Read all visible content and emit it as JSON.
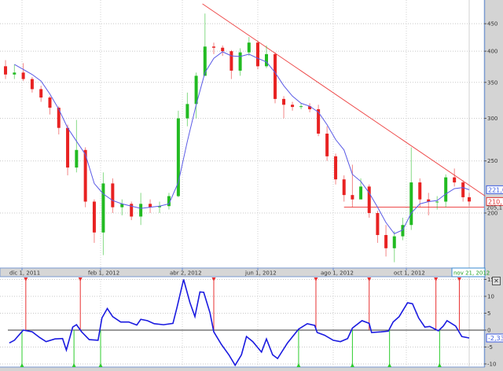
{
  "chart_data": [
    {
      "type": "candlestick",
      "panel": "price",
      "y_scale": "log",
      "ylim": [
        160,
        490
      ],
      "y_ticks": [
        "200",
        "250",
        "300",
        "350",
        "400",
        "450"
      ],
      "x_ticks": [
        "dic 1, 2011",
        "feb 1, 2012",
        "abr 2, 2012",
        "jun 1, 2012",
        "ago 1, 2012",
        "oct 1, 2012"
      ],
      "grid": true,
      "cursor_date_label": "nov 21, 2012",
      "colors": {
        "up": "#22bb22",
        "down": "#e82222",
        "ma": "#5a5ae6",
        "trendline": "#ee4a4a"
      },
      "ohlc": [
        {
          "date": "2011-11-18",
          "o": 375,
          "h": 385,
          "l": 355,
          "c": 362
        },
        {
          "date": "2011-11-25",
          "o": 362,
          "h": 378,
          "l": 355,
          "c": 365
        },
        {
          "date": "2011-12-02",
          "o": 365,
          "h": 380,
          "l": 352,
          "c": 355
        },
        {
          "date": "2011-12-09",
          "o": 355,
          "h": 358,
          "l": 335,
          "c": 340
        },
        {
          "date": "2011-12-16",
          "o": 340,
          "h": 345,
          "l": 322,
          "c": 328
        },
        {
          "date": "2011-12-23",
          "o": 328,
          "h": 330,
          "l": 305,
          "c": 314
        },
        {
          "date": "2011-12-30",
          "o": 314,
          "h": 316,
          "l": 280,
          "c": 288
        },
        {
          "date": "2012-01-06",
          "o": 288,
          "h": 292,
          "l": 235,
          "c": 243
        },
        {
          "date": "2012-01-13",
          "o": 243,
          "h": 298,
          "l": 238,
          "c": 262
        },
        {
          "date": "2012-01-20",
          "o": 262,
          "h": 265,
          "l": 205,
          "c": 210
        },
        {
          "date": "2012-01-27",
          "o": 210,
          "h": 212,
          "l": 176,
          "c": 184
        },
        {
          "date": "2012-02-03",
          "o": 184,
          "h": 238,
          "l": 167,
          "c": 227
        },
        {
          "date": "2012-02-10",
          "o": 227,
          "h": 232,
          "l": 200,
          "c": 205
        },
        {
          "date": "2012-02-17",
          "o": 205,
          "h": 212,
          "l": 198,
          "c": 208
        },
        {
          "date": "2012-02-24",
          "o": 208,
          "h": 210,
          "l": 194,
          "c": 197
        },
        {
          "date": "2012-03-02",
          "o": 197,
          "h": 218,
          "l": 190,
          "c": 208
        },
        {
          "date": "2012-03-09",
          "o": 208,
          "h": 212,
          "l": 200,
          "c": 205
        },
        {
          "date": "2012-03-16",
          "o": 205,
          "h": 210,
          "l": 200,
          "c": 206
        },
        {
          "date": "2012-03-23",
          "o": 206,
          "h": 218,
          "l": 203,
          "c": 215
        },
        {
          "date": "2012-03-30",
          "o": 215,
          "h": 310,
          "l": 214,
          "c": 300
        },
        {
          "date": "2012-04-06",
          "o": 300,
          "h": 335,
          "l": 290,
          "c": 319
        },
        {
          "date": "2012-04-13",
          "o": 319,
          "h": 365,
          "l": 300,
          "c": 360
        },
        {
          "date": "2012-04-20",
          "o": 360,
          "h": 470,
          "l": 360,
          "c": 408
        },
        {
          "date": "2012-04-27",
          "o": 408,
          "h": 415,
          "l": 395,
          "c": 406
        },
        {
          "date": "2012-05-04",
          "o": 406,
          "h": 410,
          "l": 392,
          "c": 400
        },
        {
          "date": "2012-05-11",
          "o": 400,
          "h": 402,
          "l": 355,
          "c": 368
        },
        {
          "date": "2012-05-18",
          "o": 368,
          "h": 405,
          "l": 360,
          "c": 398
        },
        {
          "date": "2012-05-25",
          "o": 398,
          "h": 425,
          "l": 392,
          "c": 415
        },
        {
          "date": "2012-06-01",
          "o": 415,
          "h": 418,
          "l": 370,
          "c": 375
        },
        {
          "date": "2012-06-08",
          "o": 375,
          "h": 410,
          "l": 372,
          "c": 395
        },
        {
          "date": "2012-06-15",
          "o": 395,
          "h": 398,
          "l": 320,
          "c": 326
        },
        {
          "date": "2012-06-22",
          "o": 326,
          "h": 330,
          "l": 300,
          "c": 318
        },
        {
          "date": "2012-06-29",
          "o": 318,
          "h": 322,
          "l": 310,
          "c": 315
        },
        {
          "date": "2012-07-06",
          "o": 315,
          "h": 320,
          "l": 312,
          "c": 316
        },
        {
          "date": "2012-07-13",
          "o": 316,
          "h": 320,
          "l": 308,
          "c": 312
        },
        {
          "date": "2012-07-20",
          "o": 312,
          "h": 318,
          "l": 278,
          "c": 281
        },
        {
          "date": "2012-07-27",
          "o": 281,
          "h": 290,
          "l": 250,
          "c": 255
        },
        {
          "date": "2012-08-03",
          "o": 255,
          "h": 258,
          "l": 226,
          "c": 231
        },
        {
          "date": "2012-08-10",
          "o": 231,
          "h": 235,
          "l": 210,
          "c": 216
        },
        {
          "date": "2012-08-17",
          "o": 216,
          "h": 246,
          "l": 205,
          "c": 212
        },
        {
          "date": "2012-08-24",
          "o": 212,
          "h": 232,
          "l": 215,
          "c": 224
        },
        {
          "date": "2012-08-31",
          "o": 224,
          "h": 226,
          "l": 196,
          "c": 200
        },
        {
          "date": "2012-09-07",
          "o": 200,
          "h": 202,
          "l": 176,
          "c": 182
        },
        {
          "date": "2012-09-14",
          "o": 182,
          "h": 190,
          "l": 166,
          "c": 172
        },
        {
          "date": "2012-09-21",
          "o": 172,
          "h": 185,
          "l": 162,
          "c": 181
        },
        {
          "date": "2012-09-28",
          "o": 181,
          "h": 196,
          "l": 178,
          "c": 190
        },
        {
          "date": "2012-10-05",
          "o": 190,
          "h": 265,
          "l": 186,
          "c": 228
        },
        {
          "date": "2012-10-12",
          "o": 228,
          "h": 232,
          "l": 205,
          "c": 212
        },
        {
          "date": "2012-10-19",
          "o": 212,
          "h": 218,
          "l": 198,
          "c": 210
        },
        {
          "date": "2012-10-26",
          "o": 210,
          "h": 215,
          "l": 203,
          "c": 210
        },
        {
          "date": "2012-11-02",
          "o": 210,
          "h": 236,
          "l": 205,
          "c": 233
        },
        {
          "date": "2012-11-09",
          "o": 233,
          "h": 242,
          "l": 224,
          "c": 228
        },
        {
          "date": "2012-11-16",
          "o": 228,
          "h": 230,
          "l": 210,
          "c": 214
        },
        {
          "date": "2012-11-21",
          "o": 214,
          "h": 218,
          "l": 206,
          "c": 210.1
        }
      ],
      "moving_average": [
        {
          "date": "2011-11-25",
          "v": 378
        },
        {
          "date": "2011-12-02",
          "v": 370
        },
        {
          "date": "2011-12-09",
          "v": 362
        },
        {
          "date": "2011-12-16",
          "v": 352
        },
        {
          "date": "2011-12-23",
          "v": 333
        },
        {
          "date": "2011-12-30",
          "v": 312
        },
        {
          "date": "2012-01-06",
          "v": 288
        },
        {
          "date": "2012-01-13",
          "v": 272
        },
        {
          "date": "2012-01-20",
          "v": 257
        },
        {
          "date": "2012-01-27",
          "v": 227
        },
        {
          "date": "2012-02-03",
          "v": 217
        },
        {
          "date": "2012-02-10",
          "v": 211
        },
        {
          "date": "2012-02-17",
          "v": 208
        },
        {
          "date": "2012-02-24",
          "v": 206
        },
        {
          "date": "2012-03-02",
          "v": 204
        },
        {
          "date": "2012-03-09",
          "v": 205
        },
        {
          "date": "2012-03-16",
          "v": 206
        },
        {
          "date": "2012-03-23",
          "v": 208
        },
        {
          "date": "2012-03-30",
          "v": 228
        },
        {
          "date": "2012-04-06",
          "v": 272
        },
        {
          "date": "2012-04-13",
          "v": 318
        },
        {
          "date": "2012-04-20",
          "v": 365
        },
        {
          "date": "2012-04-27",
          "v": 388
        },
        {
          "date": "2012-05-04",
          "v": 399
        },
        {
          "date": "2012-05-11",
          "v": 392
        },
        {
          "date": "2012-05-18",
          "v": 391
        },
        {
          "date": "2012-05-25",
          "v": 395
        },
        {
          "date": "2012-06-01",
          "v": 388
        },
        {
          "date": "2012-06-08",
          "v": 382
        },
        {
          "date": "2012-06-15",
          "v": 365
        },
        {
          "date": "2012-06-22",
          "v": 345
        },
        {
          "date": "2012-06-29",
          "v": 330
        },
        {
          "date": "2012-07-06",
          "v": 320
        },
        {
          "date": "2012-07-13",
          "v": 316
        },
        {
          "date": "2012-07-20",
          "v": 308
        },
        {
          "date": "2012-07-27",
          "v": 292
        },
        {
          "date": "2012-08-03",
          "v": 274
        },
        {
          "date": "2012-08-10",
          "v": 262
        },
        {
          "date": "2012-08-17",
          "v": 236
        },
        {
          "date": "2012-08-24",
          "v": 229
        },
        {
          "date": "2012-08-31",
          "v": 218
        },
        {
          "date": "2012-09-07",
          "v": 205
        },
        {
          "date": "2012-09-14",
          "v": 192
        },
        {
          "date": "2012-09-21",
          "v": 183
        },
        {
          "date": "2012-09-28",
          "v": 186
        },
        {
          "date": "2012-10-05",
          "v": 200
        },
        {
          "date": "2012-10-12",
          "v": 208
        },
        {
          "date": "2012-10-19",
          "v": 210
        },
        {
          "date": "2012-10-26",
          "v": 211
        },
        {
          "date": "2012-11-02",
          "v": 217
        },
        {
          "date": "2012-11-09",
          "v": 222
        },
        {
          "date": "2012-11-16",
          "v": 223
        },
        {
          "date": "2012-11-21",
          "v": 221.0
        }
      ],
      "trendline": [
        {
          "date": "2012-04-18",
          "v": 490
        },
        {
          "date": "2012-12-04",
          "v": 215
        }
      ],
      "support_line": {
        "from": "2012-08-10",
        "value": 205.1
      },
      "value_labels": {
        "ma": "221,0",
        "last": "210,1",
        "support": "205,1"
      }
    },
    {
      "type": "line",
      "panel": "oscillator",
      "ylim": [
        -11,
        16
      ],
      "y_ticks": [
        "15",
        "10",
        "5",
        "0",
        "-5",
        "-10"
      ],
      "zero_line": true,
      "grid": true,
      "colors": {
        "line": "#1a1ae0",
        "sell": "#e83030",
        "buy": "#2ccc2c"
      },
      "last_value_label": "-2,33",
      "series": [
        {
          "date": "2011-11-21",
          "v": -3.8
        },
        {
          "date": "2011-11-25",
          "v": -3
        },
        {
          "date": "2011-12-02",
          "v": 0
        },
        {
          "date": "2011-12-09",
          "v": -0.5
        },
        {
          "date": "2011-12-15",
          "v": -2.2
        },
        {
          "date": "2011-12-20",
          "v": -3.4
        },
        {
          "date": "2011-12-27",
          "v": -2.6
        },
        {
          "date": "2012-01-02",
          "v": -2.5
        },
        {
          "date": "2012-01-05",
          "v": -5.9
        },
        {
          "date": "2012-01-10",
          "v": 0.9
        },
        {
          "date": "2012-01-13",
          "v": 1.6
        },
        {
          "date": "2012-01-17",
          "v": -0.5
        },
        {
          "date": "2012-01-23",
          "v": -2.8
        },
        {
          "date": "2012-01-30",
          "v": -3
        },
        {
          "date": "2012-02-02",
          "v": 3.6
        },
        {
          "date": "2012-02-06",
          "v": 6.4
        },
        {
          "date": "2012-02-10",
          "v": 4
        },
        {
          "date": "2012-02-16",
          "v": 2.4
        },
        {
          "date": "2012-02-22",
          "v": 2.4
        },
        {
          "date": "2012-02-28",
          "v": 1.5
        },
        {
          "date": "2012-03-02",
          "v": 3.2
        },
        {
          "date": "2012-03-07",
          "v": 2.8
        },
        {
          "date": "2012-03-12",
          "v": 1.9
        },
        {
          "date": "2012-03-19",
          "v": 1.6
        },
        {
          "date": "2012-03-26",
          "v": 2
        },
        {
          "date": "2012-03-29",
          "v": 6.7
        },
        {
          "date": "2012-04-03",
          "v": 15
        },
        {
          "date": "2012-04-08",
          "v": 8.2
        },
        {
          "date": "2012-04-12",
          "v": 4
        },
        {
          "date": "2012-04-16",
          "v": 11.3
        },
        {
          "date": "2012-04-19",
          "v": 11.2
        },
        {
          "date": "2012-04-24",
          "v": 5.1
        },
        {
          "date": "2012-04-27",
          "v": -0.5
        },
        {
          "date": "2012-05-03",
          "v": -4.2
        },
        {
          "date": "2012-05-09",
          "v": -7.3
        },
        {
          "date": "2012-05-14",
          "v": -10.4
        },
        {
          "date": "2012-05-19",
          "v": -7.3
        },
        {
          "date": "2012-05-23",
          "v": -1.9
        },
        {
          "date": "2012-05-28",
          "v": -3.4
        },
        {
          "date": "2012-06-04",
          "v": -6.5
        },
        {
          "date": "2012-06-08",
          "v": -2.6
        },
        {
          "date": "2012-06-13",
          "v": -7.3
        },
        {
          "date": "2012-06-17",
          "v": -8.4
        },
        {
          "date": "2012-06-25",
          "v": -3.8
        },
        {
          "date": "2012-07-04",
          "v": 0.3
        },
        {
          "date": "2012-07-11",
          "v": 1.9
        },
        {
          "date": "2012-07-17",
          "v": 1.4
        },
        {
          "date": "2012-07-19",
          "v": -0.7
        },
        {
          "date": "2012-07-25",
          "v": -1.5
        },
        {
          "date": "2012-08-01",
          "v": -3
        },
        {
          "date": "2012-08-07",
          "v": -3.4
        },
        {
          "date": "2012-08-13",
          "v": -2.5
        },
        {
          "date": "2012-08-17",
          "v": 0.6
        },
        {
          "date": "2012-08-25",
          "v": 2.8
        },
        {
          "date": "2012-08-31",
          "v": 2
        },
        {
          "date": "2012-09-02",
          "v": -0.7
        },
        {
          "date": "2012-09-10",
          "v": -0.5
        },
        {
          "date": "2012-09-16",
          "v": -0.3
        },
        {
          "date": "2012-09-20",
          "v": 2.4
        },
        {
          "date": "2012-09-25",
          "v": 4
        },
        {
          "date": "2012-10-02",
          "v": 8.1
        },
        {
          "date": "2012-10-06",
          "v": 7.8
        },
        {
          "date": "2012-10-11",
          "v": 3.6
        },
        {
          "date": "2012-10-16",
          "v": 0.9
        },
        {
          "date": "2012-10-20",
          "v": 1.1
        },
        {
          "date": "2012-10-27",
          "v": -0.2
        },
        {
          "date": "2012-10-31",
          "v": 1.2
        },
        {
          "date": "2012-11-03",
          "v": 2.8
        },
        {
          "date": "2012-11-10",
          "v": 1.2
        },
        {
          "date": "2012-11-15",
          "v": -1.9
        },
        {
          "date": "2012-11-21",
          "v": -2.33
        }
      ],
      "sell_signals": [
        "2011-12-04",
        "2012-01-16",
        "2012-04-27",
        "2012-07-18",
        "2012-08-31",
        "2012-10-25",
        "2012-11-13"
      ],
      "buy_signals": [
        "2011-12-01",
        "2012-01-11",
        "2012-02-01",
        "2012-07-04",
        "2012-08-17",
        "2012-09-17",
        "2012-10-28"
      ]
    }
  ]
}
